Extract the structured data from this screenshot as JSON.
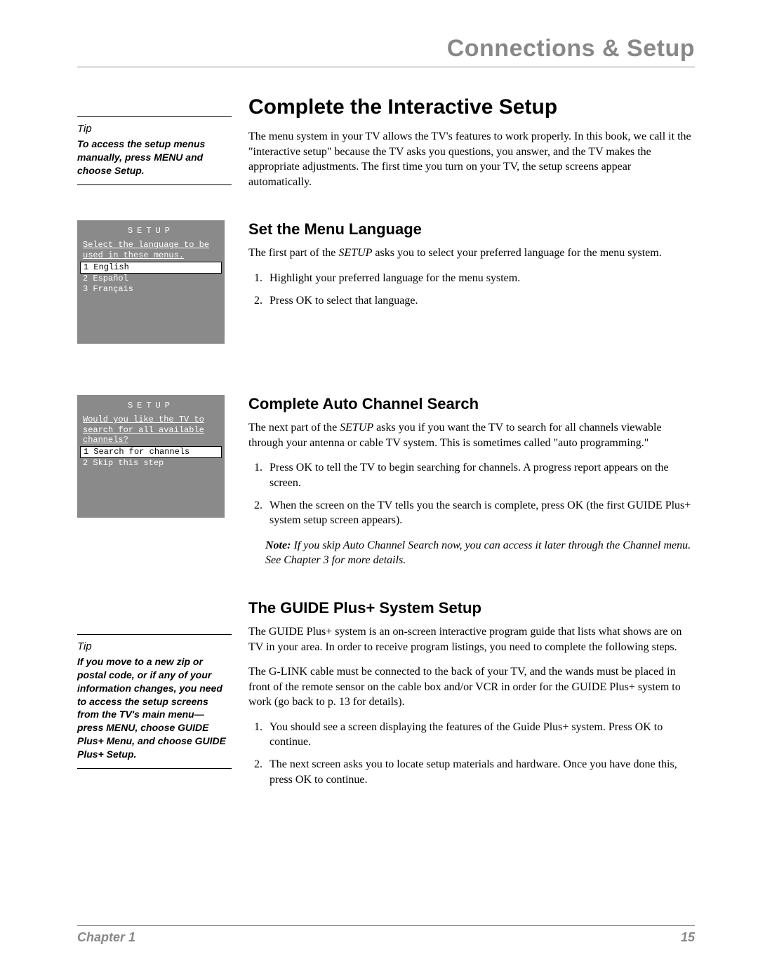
{
  "header": "Connections & Setup",
  "main": {
    "h1": "Complete the Interactive Setup",
    "intro": "The menu system in your TV allows the TV's features to work properly. In this book, we call it the \"interactive setup\" because the TV asks you questions, you answer, and the TV makes the appropriate adjustments. The first time you turn on your TV, the setup screens appear automatically.",
    "sec1": {
      "title": "Set the Menu Language",
      "p_pre": "The first part of the ",
      "p_setup": "SETUP",
      "p_post": " asks you to select your preferred language for the menu system.",
      "li1": "Highlight your preferred language for the menu system.",
      "li2": "Press OK to select that language."
    },
    "sec2": {
      "title": "Complete Auto Channel Search",
      "p_pre": "The next part of the ",
      "p_setup": "SETUP",
      "p_post": " asks you if you want the TV to search for all channels viewable through your antenna or cable TV system. This is sometimes called \"auto programming.\"",
      "li1": "Press OK to tell the TV to begin searching for channels. A progress report appears on the screen.",
      "li2": "When the screen on the TV tells you the search is complete, press OK (the first GUIDE Plus+ system setup screen appears).",
      "note_label": "Note: ",
      "note_body": " If you skip Auto Channel Search now, you can access it later through the Channel menu. See Chapter 3 for more details."
    },
    "sec3": {
      "title": "The GUIDE Plus+ System Setup",
      "p1": "The GUIDE Plus+ system is an on-screen interactive program guide that lists what shows are on TV in your area. In order to receive program listings, you need to complete the following steps.",
      "p2": "The G-LINK cable must be connected to the back of your TV, and the wands must be placed in front of the remote sensor on the cable box and/or VCR in order for the GUIDE Plus+ system to work (go back to p. 13 for details).",
      "li1": "You should see a screen displaying the features of the Guide Plus+ system. Press OK to continue.",
      "li2": "The next screen asks you to locate setup materials and hardware. Once you have done this, press OK to continue."
    }
  },
  "sidebar": {
    "tip1": {
      "title": "Tip",
      "body": "To access the setup menus manually, press MENU and choose Setup."
    },
    "box1": {
      "title": "SETUP",
      "prompt": "Select the language to be used in these menus.",
      "opt1": "1 English",
      "opt2": "2 Español",
      "opt3": "3 Français"
    },
    "box2": {
      "title": "SETUP",
      "prompt": "Would you like the TV to search for all available channels?",
      "opt1": "1 Search for channels",
      "opt2": "2 Skip this step"
    },
    "tip2": {
      "title": "Tip",
      "body": "If you move to a new zip or postal code, or if any of your information changes, you need to access the setup screens from the TV's main menu— press MENU, choose GUIDE Plus+ Menu, and choose GUIDE Plus+ Setup."
    }
  },
  "footer": {
    "chapter": "Chapter 1",
    "page": "15"
  }
}
